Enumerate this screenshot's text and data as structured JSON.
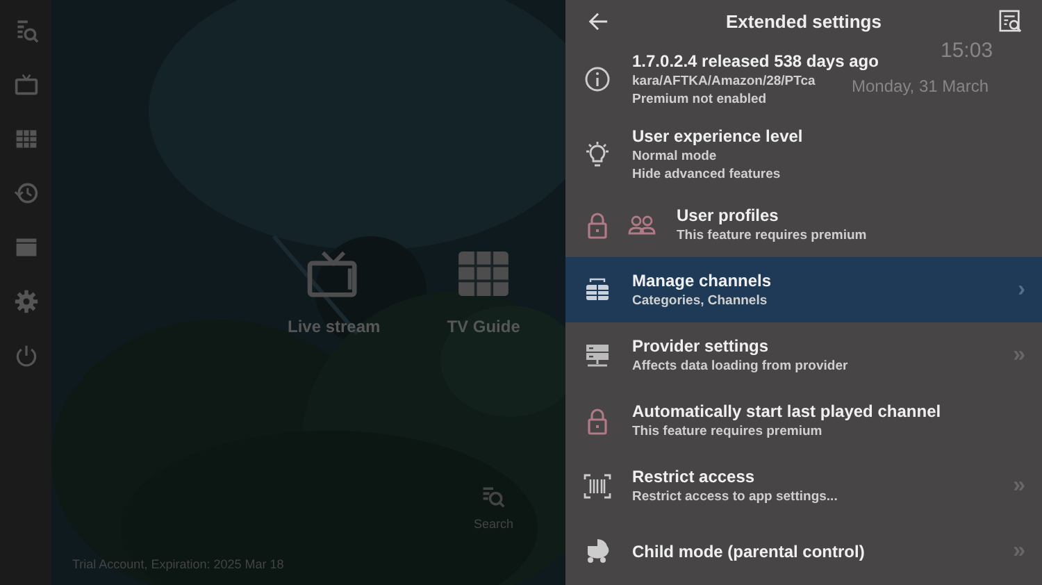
{
  "home": {
    "tiles": [
      {
        "label": "Live stream"
      },
      {
        "label": "TV Guide"
      }
    ],
    "search_shortcut": {
      "label": "Search"
    },
    "account_status": "Trial Account, Expiration: 2025 Mar 18",
    "clock": {
      "time": "15:03",
      "date": "Monday, 31 March"
    }
  },
  "panel": {
    "title": "Extended settings",
    "items": [
      {
        "title": "1.7.0.2.4 released 538 days ago",
        "lines": [
          "kara/AFTKA/Amazon/28/PTca",
          "Premium not enabled"
        ],
        "locked": false,
        "selected": false
      },
      {
        "title": "User experience level",
        "lines": [
          "Normal mode",
          "Hide advanced features"
        ],
        "locked": false,
        "selected": false
      },
      {
        "title": "User profiles",
        "lines": [
          "This feature requires premium"
        ],
        "locked": true,
        "selected": false
      },
      {
        "title": "Manage channels",
        "lines": [
          "Categories, Channels"
        ],
        "locked": false,
        "selected": true,
        "arrow": "›"
      },
      {
        "title": "Provider settings",
        "lines": [
          "Affects data loading from provider"
        ],
        "locked": false,
        "selected": false,
        "arrow": "»"
      },
      {
        "title": "Automatically start last played channel",
        "lines": [
          "This feature requires premium"
        ],
        "locked": true,
        "selected": false
      },
      {
        "title": "Restrict access",
        "lines": [
          "Restrict access to app settings..."
        ],
        "locked": false,
        "selected": false,
        "arrow": "»"
      },
      {
        "title": "Child mode (parental control)",
        "locked": false,
        "selected": false,
        "arrow": "»"
      }
    ]
  }
}
